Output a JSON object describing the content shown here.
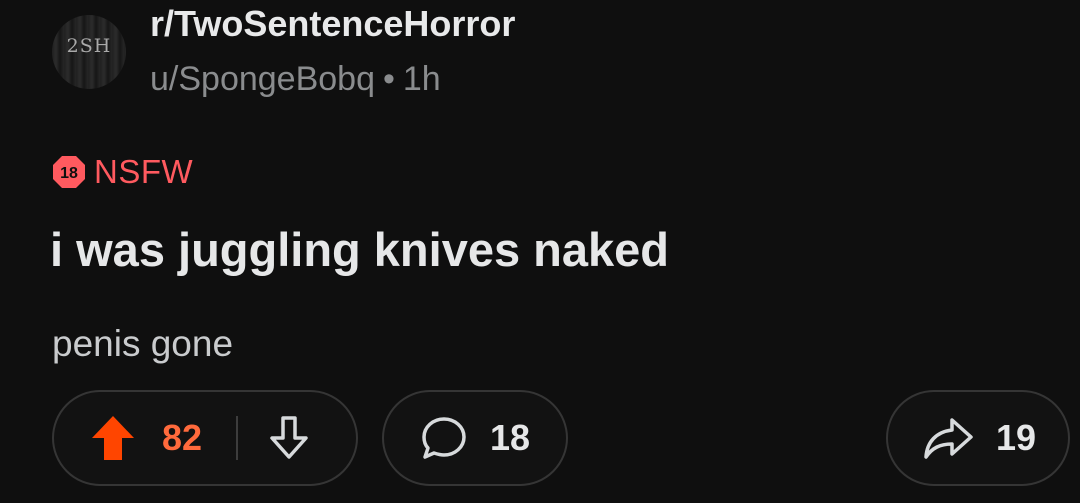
{
  "post": {
    "subreddit": "r/TwoSentenceHorror",
    "subreddit_icon_text": "2SH",
    "author": "u/SpongeBobq",
    "separator": "•",
    "age": "1h",
    "nsfw_badge_number": "18",
    "nsfw_label": "NSFW",
    "title": "i was juggling knives naked",
    "body": "penis gone"
  },
  "actions": {
    "score": "82",
    "comments": "18",
    "shares": "19"
  },
  "colors": {
    "background": "#0f0f0f",
    "nsfw": "#ff5a5f",
    "upvote": "#ff6a3c",
    "muted": "#8a8c8e"
  },
  "icons": {
    "upvote": "upvote-arrow-icon",
    "downvote": "downvote-arrow-icon",
    "comment": "comment-bubble-icon",
    "share": "share-arrow-icon",
    "nsfw": "nsfw-18-badge-icon"
  }
}
